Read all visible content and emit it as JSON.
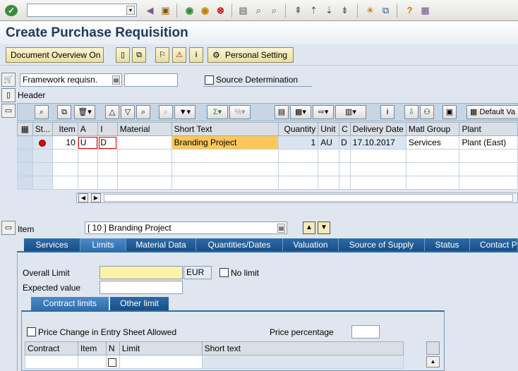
{
  "title": "Create Purchase Requisition",
  "toolbar": {
    "doc_overview_label": "Document Overview On",
    "personal_setting_label": "Personal Setting"
  },
  "header_area": {
    "doc_type_value": "Framework requisn.",
    "source_determination_label": "Source Determination",
    "header_label": "Header"
  },
  "grid_toolbar": {
    "default_values_label": "Default Va"
  },
  "grid": {
    "columns": [
      "St...",
      "Item",
      "A",
      "I",
      "Material",
      "Short Text",
      "Quantity",
      "Unit",
      "C",
      "Delivery Date",
      "Matl Group",
      "Plant"
    ],
    "row": {
      "item": "10",
      "account_assignment": "U",
      "item_category": "D",
      "material": "",
      "short_text": "Branding Project",
      "quantity": "1",
      "unit": "AU",
      "c": "D",
      "delivery_date": "17.10.2017",
      "matl_group": "Services",
      "plant": "Plant (East)"
    }
  },
  "item_detail": {
    "item_label": "Item",
    "item_value": "[ 10 ] Branding Project",
    "tabs": [
      "Services",
      "Limits",
      "Material Data",
      "Quantities/Dates",
      "Valuation",
      "Source of Supply",
      "Status",
      "Contact P"
    ],
    "active_tab": "Limits",
    "overall_limit_label": "Overall Limit",
    "currency": "EUR",
    "no_limit_label": "No limit",
    "expected_value_label": "Expected value",
    "subtabs": [
      "Contract limits",
      "Other limit"
    ],
    "price_change_label": "Price Change in Entry Sheet Allowed",
    "price_percentage_label": "Price percentage",
    "contract_table_columns": [
      "Contract",
      "Item",
      "N",
      "Limit",
      "Short text"
    ]
  },
  "colors": {
    "tab_blue": "#2f6daa",
    "required_highlight": "#fbc75a",
    "status_red": "#e00000"
  }
}
